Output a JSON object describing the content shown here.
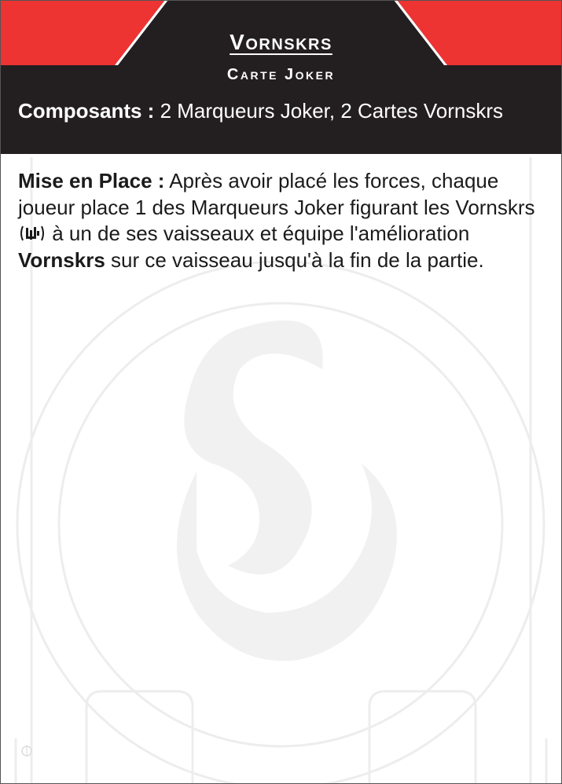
{
  "card": {
    "title": "Vornskrs",
    "subtitle": "Carte Joker",
    "components_label": "Composants :",
    "components_value": "2 Marqueurs Joker, 2 Cartes Vornskrs",
    "setup_label": "Mise en Place :",
    "setup_text_1": "Après avoir placé les forces, chaque joueur place 1 des Marqueurs Joker figurant les Vornskrs",
    "setup_text_2": "à un de ses vaisseaux et équipe l'amélioration",
    "setup_upgrade": "Vornskrs",
    "setup_text_3": "sur ce vaisseau jusqu'à la fin de la partie.",
    "joker_icon": "vornskr-joker-icon",
    "watermark_icon": "faction-emblem-icon"
  },
  "colors": {
    "header_dark": "#231f20",
    "accent_red": "#ee3333",
    "body_text": "#1b1b1b"
  }
}
